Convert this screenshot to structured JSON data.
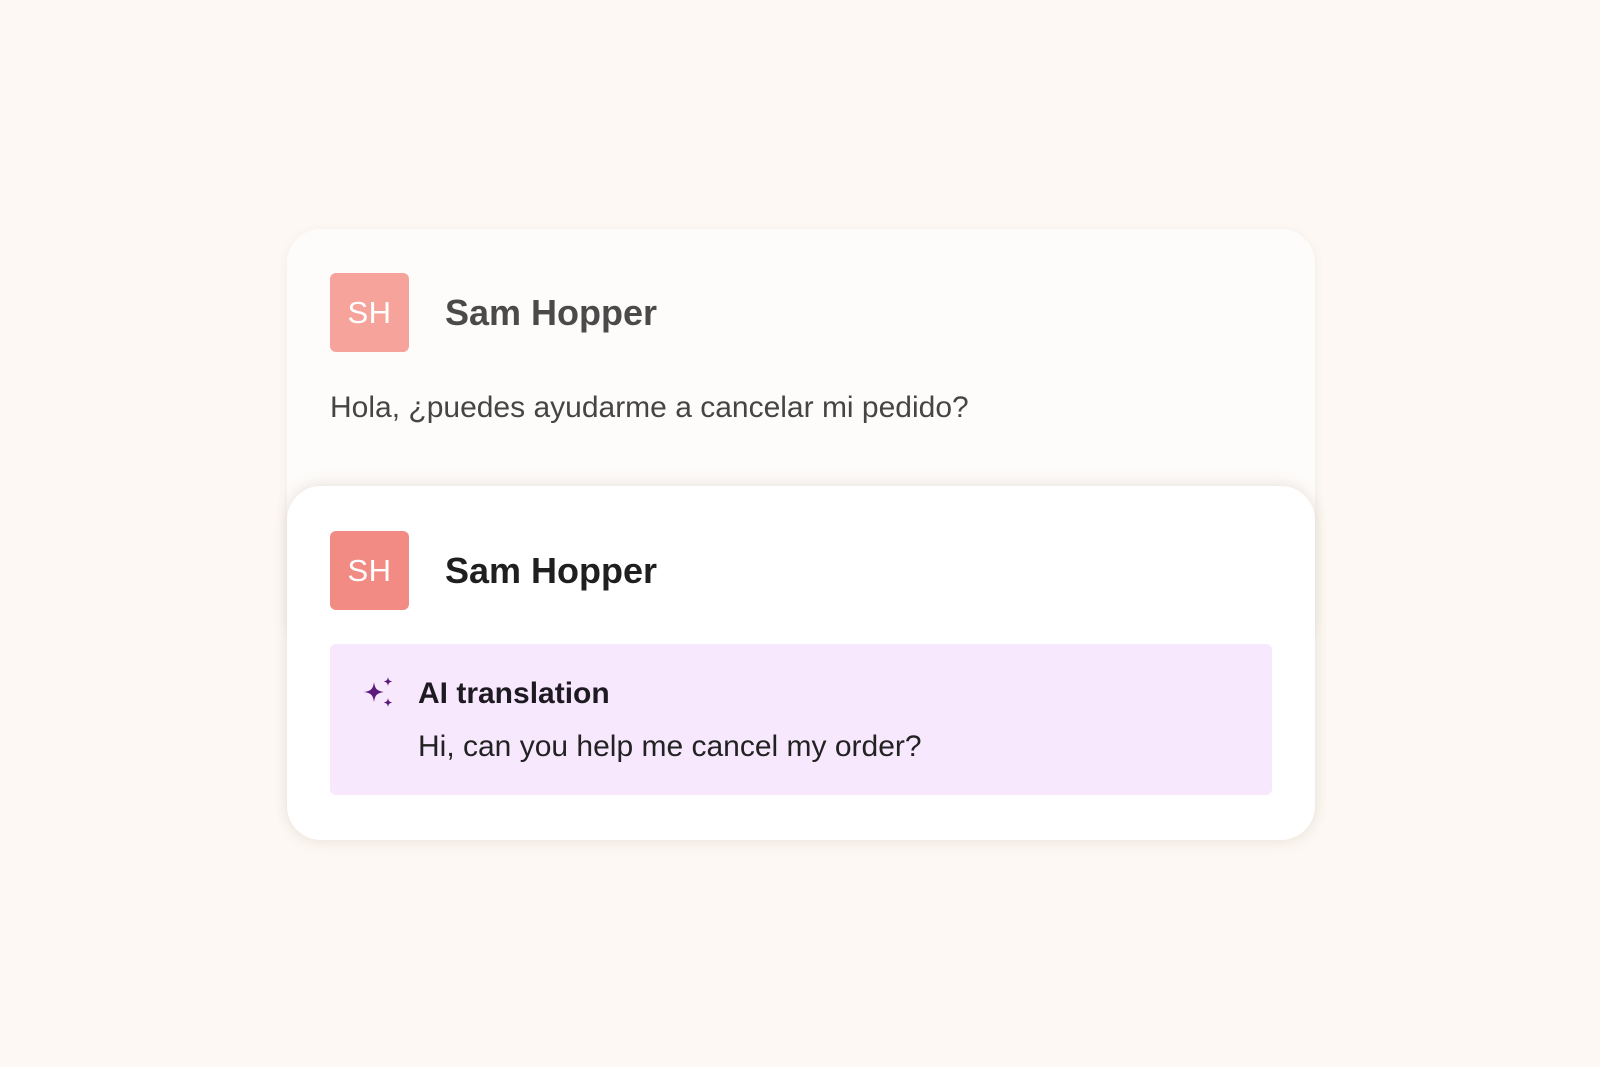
{
  "original_message": {
    "avatar_initials": "SH",
    "sender_name": "Sam Hopper",
    "text": "Hola, ¿puedes ayudarme a cancelar mi pedido?"
  },
  "translated_message": {
    "avatar_initials": "SH",
    "sender_name": "Sam Hopper",
    "translation_label": "AI translation",
    "translation_text": "Hi, can you help me cancel my order?",
    "icon": "sparkle-icon"
  },
  "colors": {
    "background": "#fdf8f3",
    "avatar_back": "#f5a39b",
    "avatar_front": "#f28b83",
    "translation_bg": "#f7e8fd",
    "sparkle": "#5c1a7a"
  }
}
